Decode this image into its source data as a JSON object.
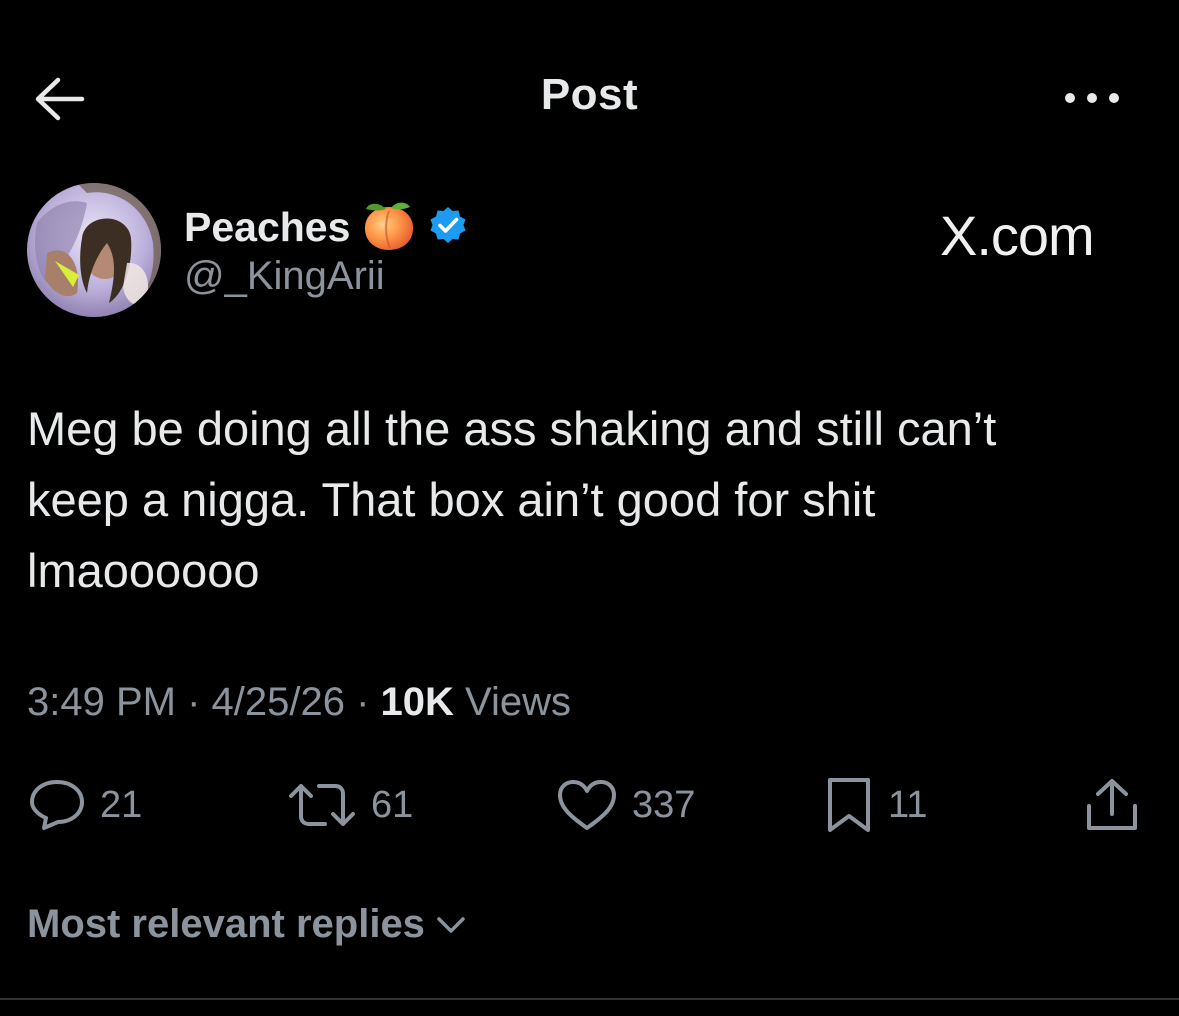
{
  "header": {
    "title": "Post",
    "back_icon": "arrow-left-icon",
    "more_icon": "more-dots-icon"
  },
  "author": {
    "name": "Peaches",
    "emoji": "🍑",
    "handle": "@_KingArii",
    "verified": true,
    "verified_color": "#1d9bf0"
  },
  "watermark": "X.com",
  "post": {
    "lines": [
      "Meg be doing all the ass shaking and still can’t",
      "keep a nigga. That box ain’t good for shit",
      "lmaoooooo"
    ]
  },
  "meta": {
    "time": "3:49 PM",
    "separator": " · ",
    "date": "4/25/26",
    "views_count": "10K",
    "views_label": "Views"
  },
  "actions": {
    "replies": "21",
    "reposts": "61",
    "likes": "337",
    "bookmarks": "11"
  },
  "replies_sort": {
    "label": "Most relevant replies"
  },
  "colors": {
    "background": "#000000",
    "text_primary": "#e7e9ea",
    "text_secondary": "#8b949c",
    "divider": "#2f3336"
  }
}
